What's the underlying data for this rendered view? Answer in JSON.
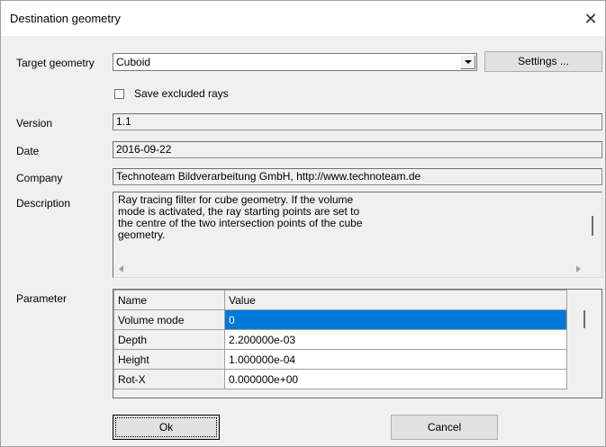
{
  "dialog": {
    "title": "Destination geometry",
    "close_glyph": "✕"
  },
  "target": {
    "label": "Target geometry",
    "value": "Cuboid",
    "settings_label": "Settings ..."
  },
  "save_excluded": {
    "label": "Save excluded rays",
    "checked": false
  },
  "info": {
    "version_label": "Version",
    "version_value": "1.1",
    "date_label": "Date",
    "date_value": "2016-09-22",
    "company_label": "Company",
    "company_value": "Technoteam Bildverarbeitung GmbH, http://www.technoteam.de",
    "description_label": "Description",
    "description_lines": [
      "Ray tracing filter for cube geometry. If the volume",
      "mode is activated, the ray starting points are set to",
      "the centre of the two intersection points of the cube",
      "geometry."
    ]
  },
  "parameter": {
    "label": "Parameter",
    "columns": [
      "Name",
      "Value"
    ],
    "rows": [
      {
        "name": "Volume mode",
        "value": "0",
        "selected": true
      },
      {
        "name": "Depth",
        "value": "2.200000e-03",
        "selected": false
      },
      {
        "name": "Height",
        "value": "1.000000e-04",
        "selected": false
      },
      {
        "name": "Rot-X",
        "value": "0.000000e+00",
        "selected": false
      }
    ]
  },
  "buttons": {
    "ok_label": "Ok",
    "cancel_label": "Cancel"
  },
  "icons": {
    "close": "close-icon",
    "dropdown": "chevron-down-icon",
    "scroll_left": "arrow-left-icon",
    "scroll_right": "arrow-right-icon"
  },
  "colors": {
    "selection": "#0078d7",
    "dialog_bg": "#f0f0f0"
  }
}
